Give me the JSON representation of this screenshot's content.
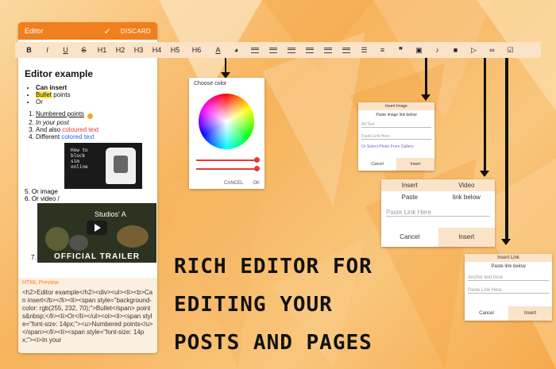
{
  "editor": {
    "title": "Editor",
    "discard_label": "DISCARD",
    "heading": "Editor example",
    "bullets": [
      "Can insert",
      "Bullet",
      " points",
      "Or"
    ],
    "numbered": [
      "Numbered points",
      "In your post",
      "And also ",
      "coloured text",
      "Different ",
      "colored text"
    ],
    "image_caption": "How to\nblock\nsim\nonline",
    "numbered2": [
      "Or image",
      "Or video /"
    ],
    "video_title": "Studios' A",
    "video_caption": "OFFICIAL TRAILER",
    "item7": "7.",
    "preview_label": "HTML Preview",
    "preview_code": "<h2>Editor example</h2><div><ul><li><b>Can insert</b></li><li><span style=\"background-color: rgb(255, 232, 70);\">Bullet</span> points&nbsp;</li><li>Or</li></ul><ol><li><span style=\"font-size: 14px;\"><u>Numbered points</u></span></li><li><span style=\"font-size: 14px;\"><i>In your"
  },
  "toolbar": {
    "items": [
      "B",
      "I",
      "U",
      "S",
      "H1",
      "H2",
      "H3",
      "H4",
      "H5",
      "H6",
      "A",
      "palette",
      "indent",
      "outdent",
      "align-left",
      "align-center",
      "align-right",
      "justify",
      "bullets",
      "numbers",
      "quote",
      "image",
      "music",
      "video",
      "youtube",
      "link",
      "checkbox"
    ]
  },
  "color_dialog": {
    "title": "Choose color",
    "cancel": "CANCEL",
    "ok": "OK"
  },
  "image_dialog": {
    "title": "Insert Image",
    "subtitle": "Paste image link below",
    "alt_placeholder": "Alt Text",
    "link_placeholder": "Paste Link Here",
    "gallery_link": "Or Select Photo From Gallery",
    "cancel": "Cancel",
    "insert": "Insert"
  },
  "video_dialog": {
    "title_left": "Insert",
    "title_right": "Video",
    "sub_left": "Paste",
    "sub_right": "link below",
    "link_placeholder": "Paste Link Here",
    "cancel": "Cancel",
    "insert": "Insert"
  },
  "link_dialog": {
    "title": "Insert Link",
    "subtitle": "Paste link below",
    "anchor_placeholder": "Anchor text here",
    "link_placeholder": "Paste Link Here",
    "cancel": "Cancel",
    "insert": "Insert"
  },
  "headline": [
    "RICH EDITOR FOR",
    "EDITING YOUR",
    "POSTS AND PAGES"
  ],
  "colors": {
    "accent": "#f07f1e",
    "toolbar_bg": "#fbe3c8",
    "highlight": "#ffe846",
    "red_text": "#e53935",
    "blue_text": "#2962ff"
  }
}
